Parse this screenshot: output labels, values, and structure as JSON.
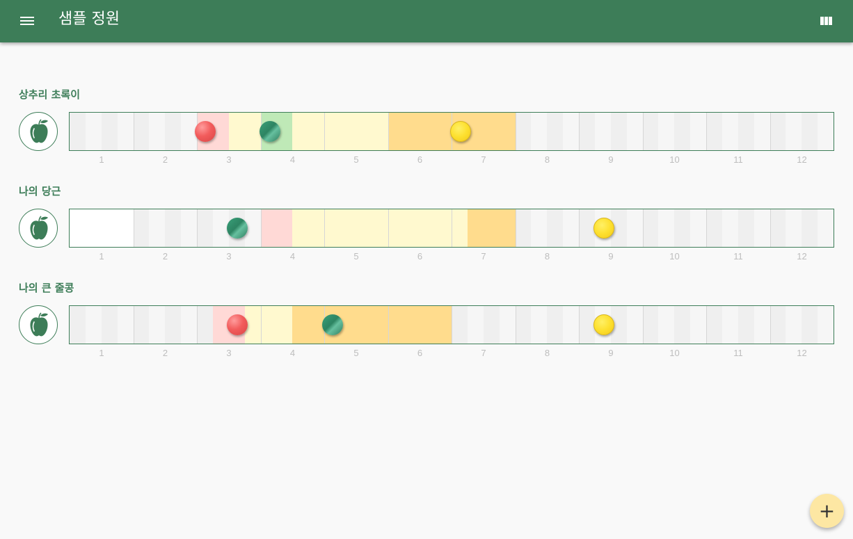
{
  "appbar": {
    "title": "샘플 정원",
    "menu_icon": "hamburger-menu-icon",
    "view_icon": "view-column-icon",
    "color": "#3d7d58"
  },
  "months": [
    "1",
    "2",
    "3",
    "4",
    "5",
    "6",
    "7",
    "8",
    "9",
    "10",
    "11",
    "12"
  ],
  "legend_colors": {
    "shade_a": "#efefef",
    "shade_b": "#f6f6f6",
    "pink": "#ffd9d6",
    "light_yellow": "#fff9cf",
    "green": "#bfe9b7",
    "orange": "#ffdc8d",
    "white": "#ffffff"
  },
  "plants": [
    {
      "name": "상추리 초록이",
      "icon": "apple-icon",
      "periods": [
        {
          "start": 3.0,
          "end": 3.5,
          "color": "pink"
        },
        {
          "start": 3.5,
          "end": 4.0,
          "color": "light_yellow"
        },
        {
          "start": 4.0,
          "end": 4.5,
          "color": "green"
        },
        {
          "start": 4.5,
          "end": 6.0,
          "color": "light_yellow"
        },
        {
          "start": 6.0,
          "end": 8.0,
          "color": "orange"
        }
      ],
      "markers": [
        {
          "type": "red",
          "month": 3.13
        },
        {
          "type": "green",
          "month": 4.15
        },
        {
          "type": "yellow",
          "month": 7.14
        }
      ]
    },
    {
      "name": "나의 당근",
      "icon": "apple-icon",
      "periods": [
        {
          "start": 1.0,
          "end": 2.0,
          "color": "white"
        },
        {
          "start": 4.0,
          "end": 4.5,
          "color": "pink"
        },
        {
          "start": 4.5,
          "end": 7.25,
          "color": "light_yellow"
        },
        {
          "start": 7.25,
          "end": 8.0,
          "color": "orange"
        }
      ],
      "markers": [
        {
          "type": "green",
          "month": 3.63
        },
        {
          "type": "yellow",
          "month": 9.39
        }
      ]
    },
    {
      "name": "나의 큰 줄콩",
      "icon": "apple-icon",
      "periods": [
        {
          "start": 3.25,
          "end": 3.75,
          "color": "pink"
        },
        {
          "start": 3.75,
          "end": 4.5,
          "color": "light_yellow"
        },
        {
          "start": 4.5,
          "end": 7.0,
          "color": "orange"
        }
      ],
      "markers": [
        {
          "type": "red",
          "month": 3.63
        },
        {
          "type": "green",
          "month": 5.13
        },
        {
          "type": "yellow",
          "month": 9.39
        }
      ]
    }
  ],
  "fab": {
    "label": "+",
    "icon": "add-icon"
  }
}
